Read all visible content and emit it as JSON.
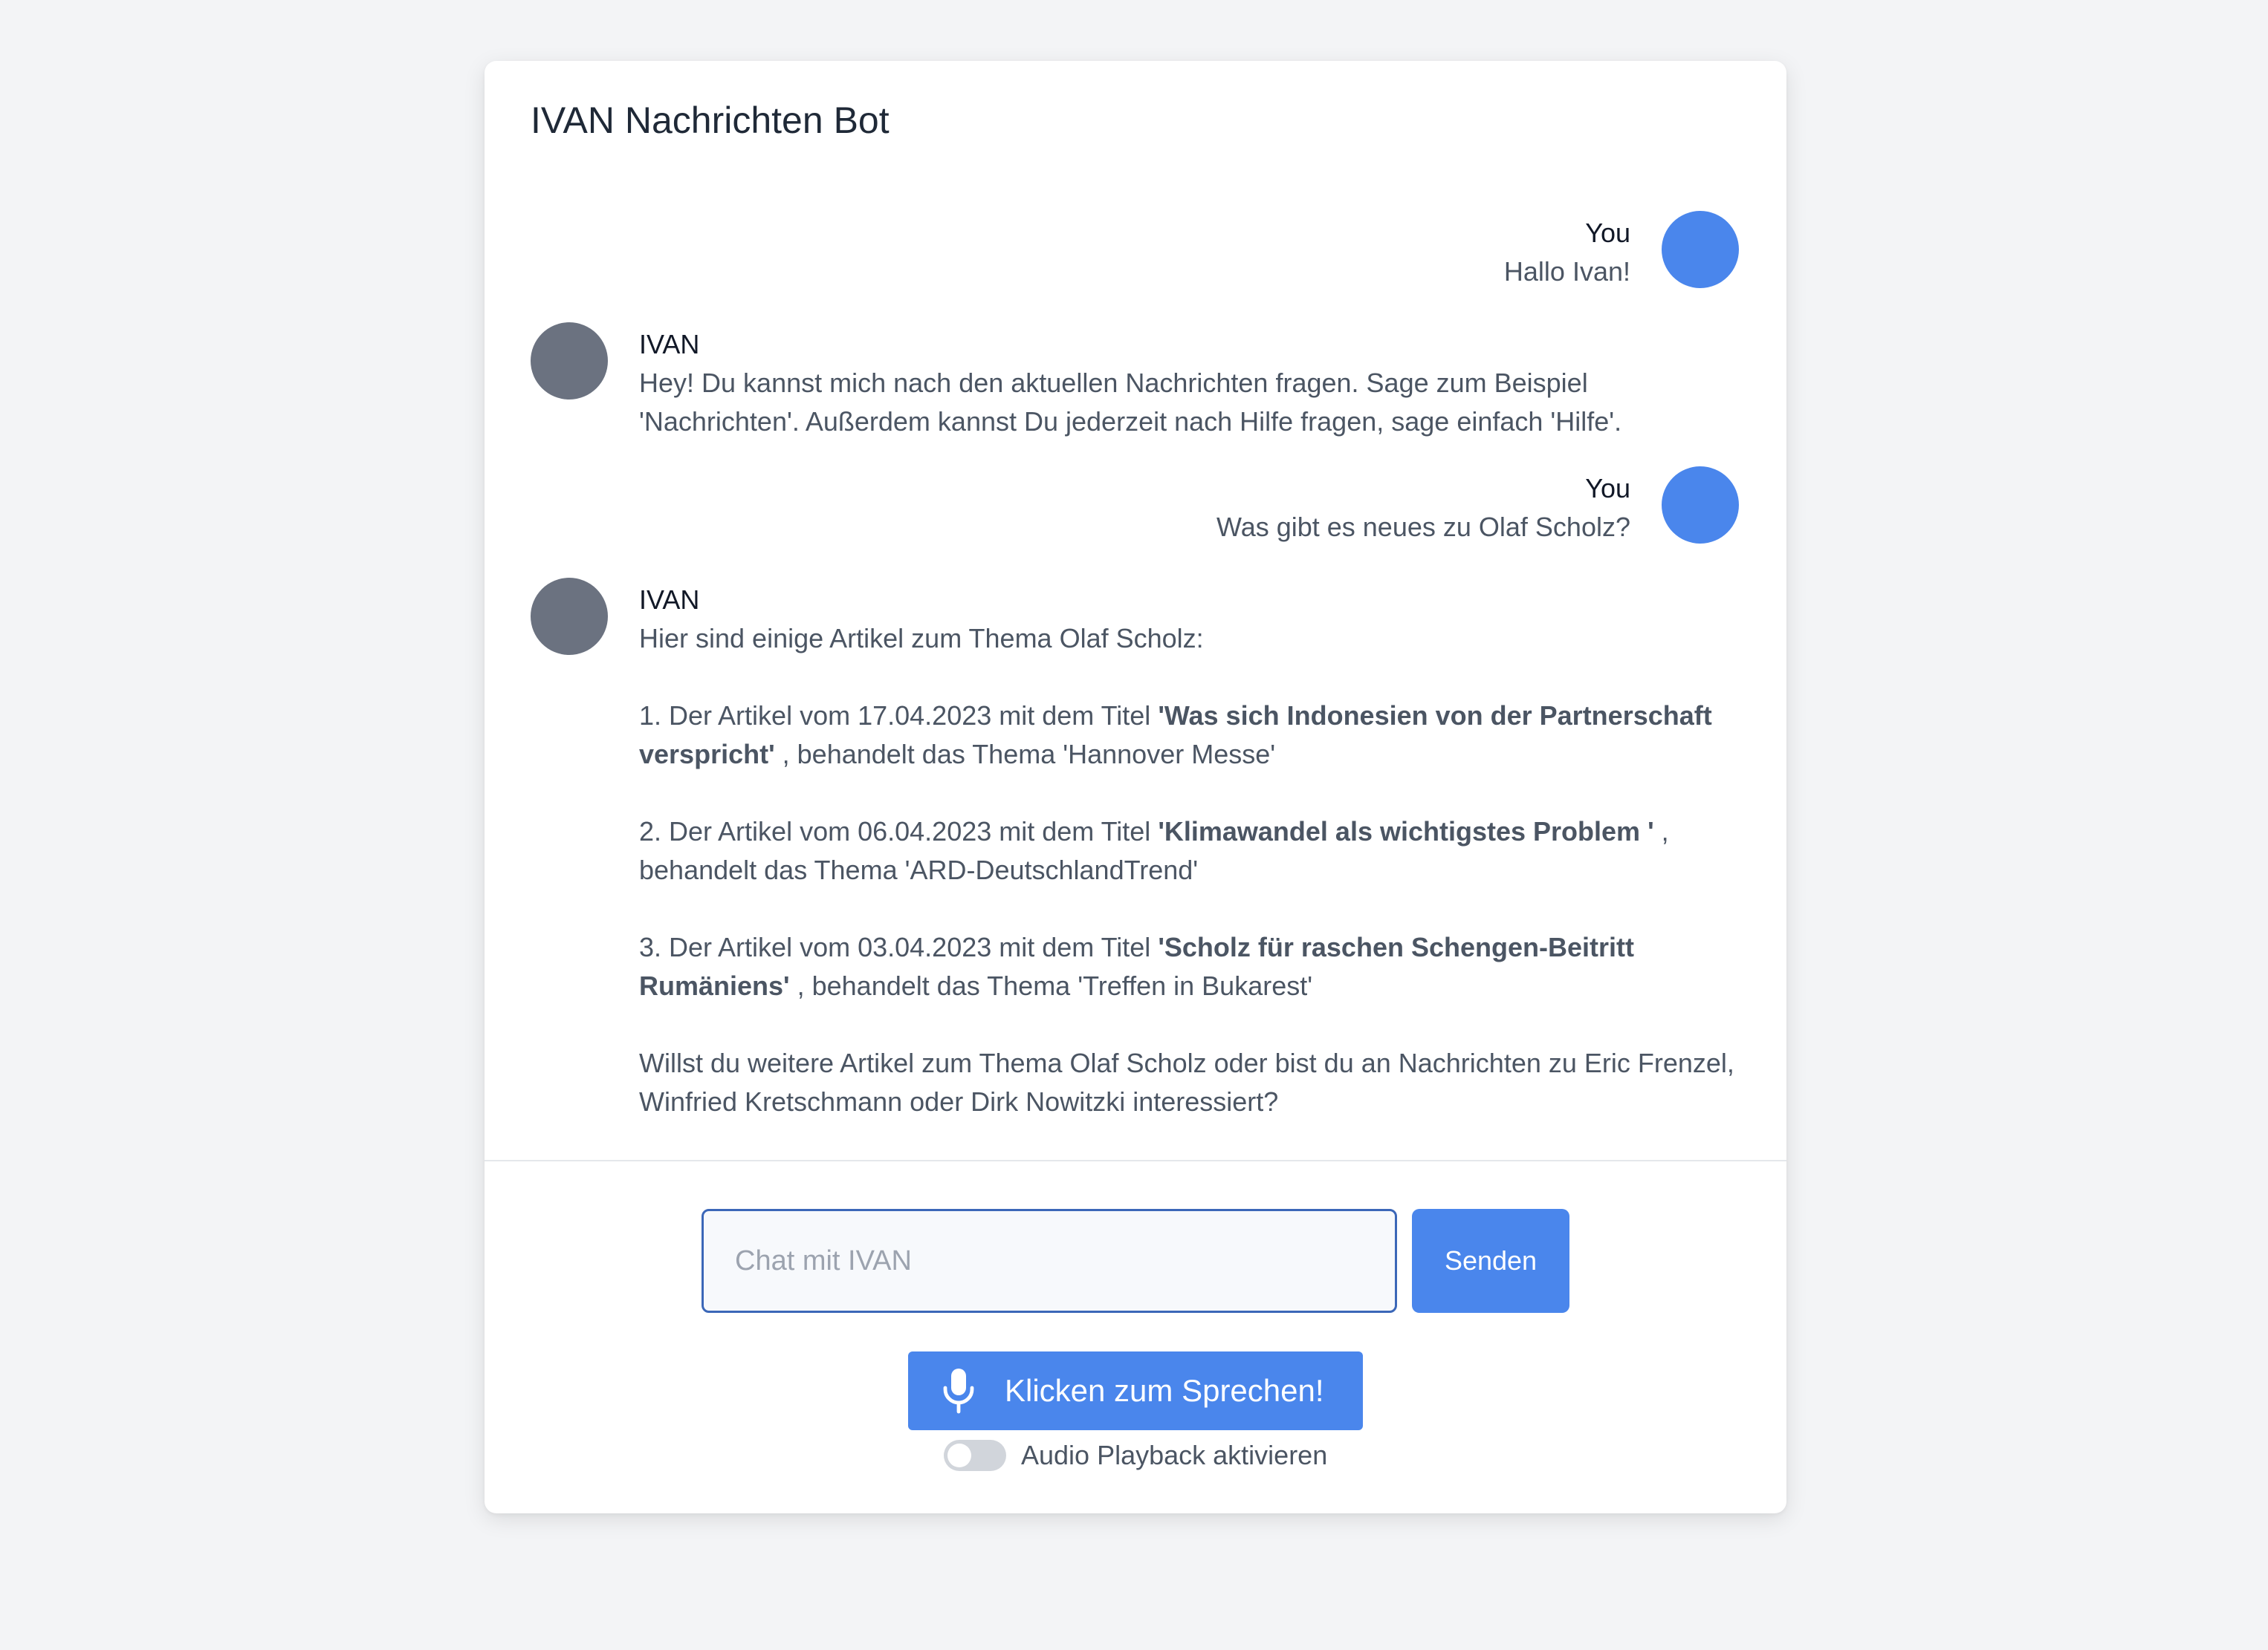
{
  "app": {
    "title": "IVAN Nachrichten Bot"
  },
  "messages": [
    {
      "sender": "You",
      "text": "Hallo Ivan!"
    },
    {
      "sender": "IVAN",
      "text": "Hey! Du kannst mich nach den aktuellen Nachrichten fragen. Sage zum Beispiel 'Nachrichten'. Außerdem kannst Du jederzeit nach Hilfe fragen, sage einfach 'Hilfe'."
    },
    {
      "sender": "You",
      "text": "Was gibt es neues zu Olaf Scholz?"
    },
    {
      "sender": "IVAN",
      "intro": "Hier sind einige Artikel zum Thema Olaf Scholz:",
      "articles": [
        {
          "prefix": "1. Der Artikel vom 17.04.2023 mit dem Titel ",
          "title": "'Was sich Indonesien von der Partnerschaft verspricht'",
          "suffix": " , behandelt das Thema 'Hannover Messe'"
        },
        {
          "prefix": "2. Der Artikel vom 06.04.2023 mit dem Titel ",
          "title": "'Klimawandel als wichtigstes Problem '",
          "suffix": " , behandelt das Thema 'ARD-DeutschlandTrend'"
        },
        {
          "prefix": "3. Der Artikel vom 03.04.2023 mit dem Titel ",
          "title": "'Scholz für raschen Schengen-Beitritt Rumäniens'",
          "suffix": " , behandelt das Thema 'Treffen in Bukarest'"
        }
      ],
      "outro": "Willst du weitere Artikel zum Thema Olaf Scholz oder bist du an Nachrichten zu Eric Frenzel, Winfried Kretschmann oder Dirk Nowitzki interessiert?"
    }
  ],
  "input": {
    "placeholder": "Chat mit IVAN",
    "value": ""
  },
  "send_label": "Senden",
  "speak": {
    "label": "Klicken zum Sprechen!",
    "icon": "microphone-icon"
  },
  "audio_toggle": {
    "label": "Audio Playback aktivieren",
    "enabled": false
  },
  "colors": {
    "accent": "#4a86ec",
    "bot_avatar": "#6b7280",
    "background": "#f3f4f6"
  }
}
